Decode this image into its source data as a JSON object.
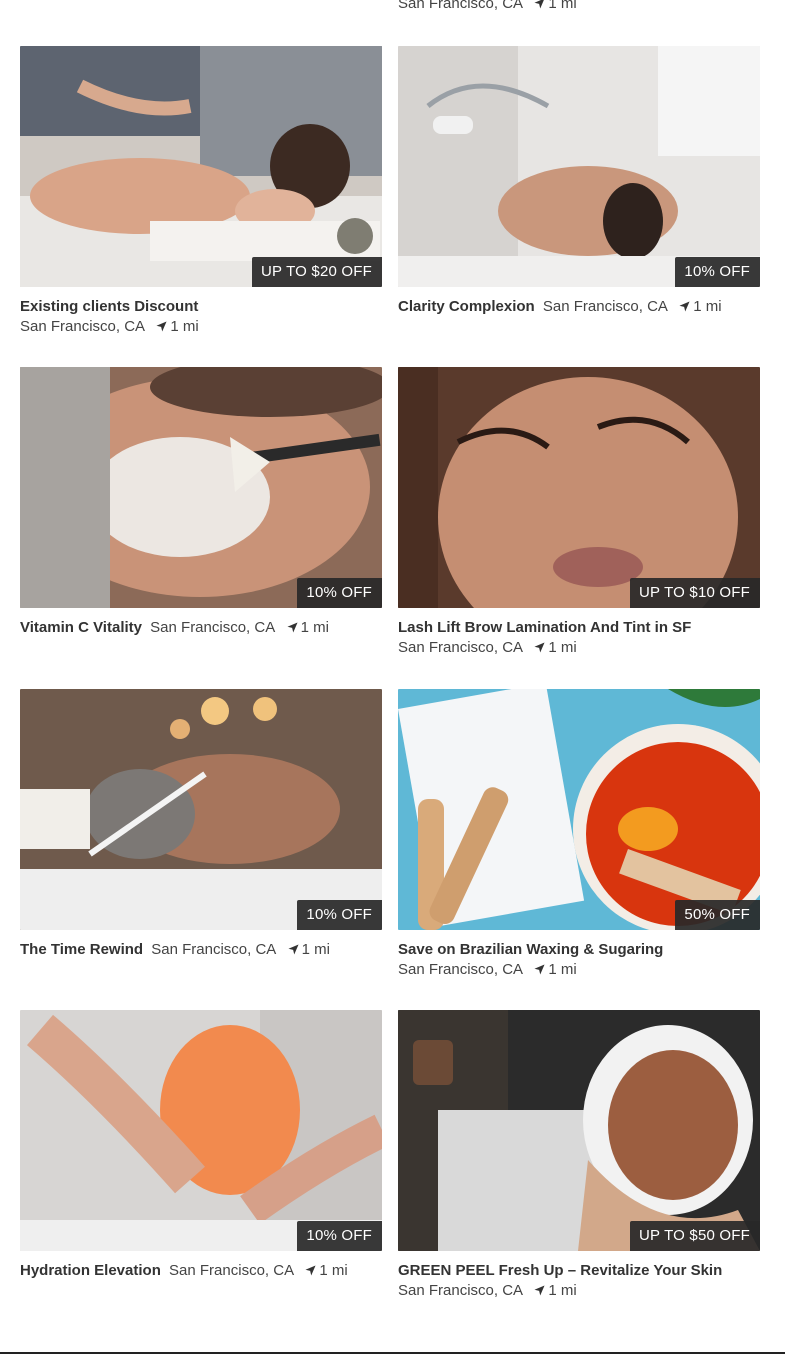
{
  "top_partial": {
    "location": "San Francisco, CA",
    "distance": "1 mi"
  },
  "cards": [
    {
      "title": "Existing clients Discount",
      "location": "San Francisco, CA",
      "distance": "1 mi",
      "badge": "UP TO $20 OFF"
    },
    {
      "title": "Clarity Complexion",
      "location": "San Francisco, CA",
      "distance": "1 mi",
      "badge": "10% OFF"
    },
    {
      "title": "Vitamin C Vitality",
      "location": "San Francisco, CA",
      "distance": "1 mi",
      "badge": "10% OFF"
    },
    {
      "title": "Lash Lift Brow Lamination And Tint in SF",
      "location": "San Francisco, CA",
      "distance": "1 mi",
      "badge": "UP TO $10 OFF"
    },
    {
      "title": "The Time Rewind",
      "location": "San Francisco, CA",
      "distance": "1 mi",
      "badge": "10% OFF"
    },
    {
      "title": "Save on Brazilian Waxing & Sugaring",
      "location": "San Francisco, CA",
      "distance": "1 mi",
      "badge": "50% OFF"
    },
    {
      "title": "Hydration Elevation",
      "location": "San Francisco, CA",
      "distance": "1 mi",
      "badge": "10% OFF"
    },
    {
      "title": "GREEN PEEL Fresh Up – Revitalize Your Skin",
      "location": "San Francisco, CA",
      "distance": "1 mi",
      "badge": "UP TO $50 OFF"
    }
  ]
}
